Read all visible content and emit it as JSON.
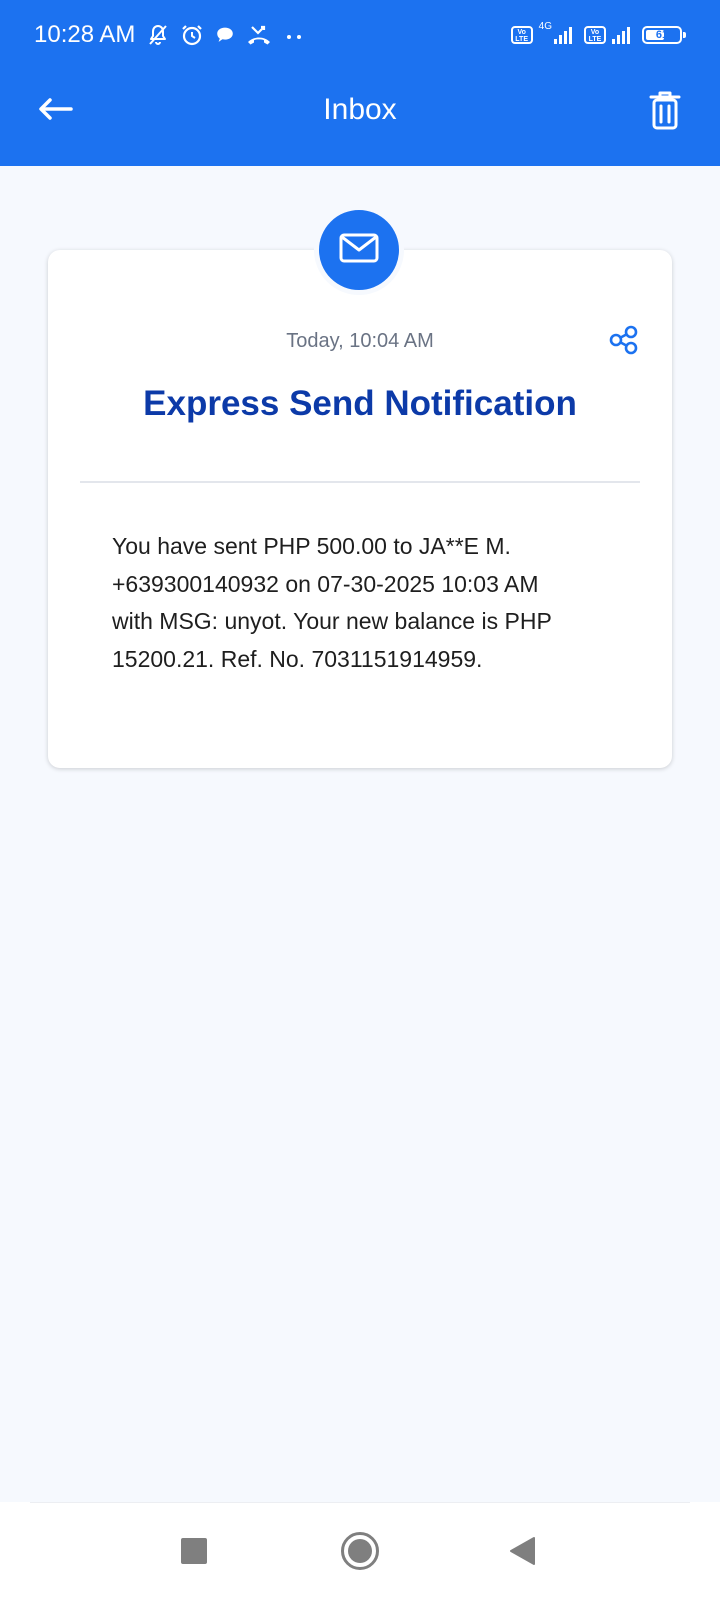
{
  "status_bar": {
    "time": "10:28 AM",
    "network_type": "4G",
    "battery_level": "61",
    "battery_fraction": 0.61,
    "volte_label": "Vo LTE",
    "left_icons": [
      "bell-off-icon",
      "alarm-icon",
      "chat-bubble-icon",
      "missed-call-icon",
      "more-dots-icon"
    ]
  },
  "header": {
    "title": "Inbox",
    "back_icon": "arrow-left-icon",
    "delete_icon": "trash-icon",
    "background_color": "#1c72f0"
  },
  "message": {
    "icon": "envelope-icon",
    "date": "Today, 10:04 AM",
    "share_icon": "share-icon",
    "title": "Express Send Notification",
    "body": "You have sent PHP 500.00 to JA**E M. +639300140932 on 07-30-2025 10:03 AM with MSG: unyot. Your new balance is PHP 15200.21. Ref. No. 7031151914959.",
    "title_color": "#0c3aa8"
  },
  "navigation": {
    "recents_icon": "square-recents-icon",
    "home_icon": "circle-home-icon",
    "back_icon": "triangle-back-icon"
  }
}
